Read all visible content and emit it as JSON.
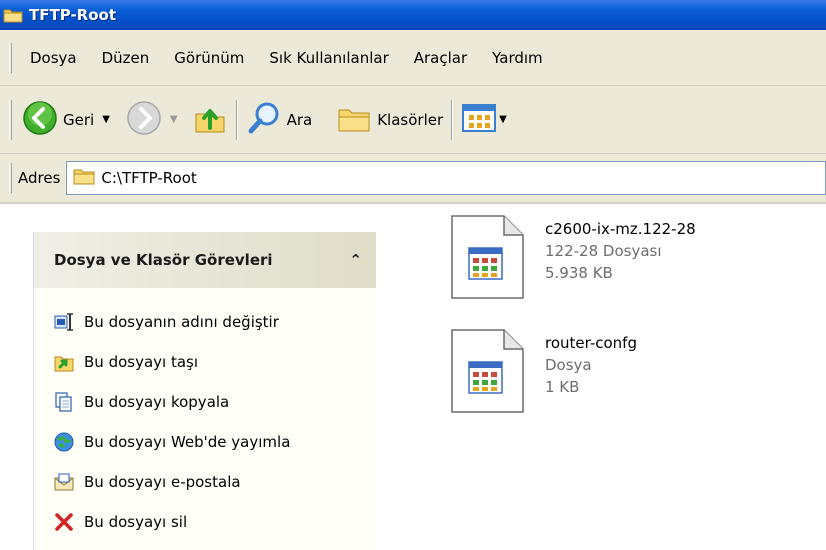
{
  "window": {
    "title": "TFTP-Root"
  },
  "menu": {
    "items": [
      "Dosya",
      "Düzen",
      "Görünüm",
      "Sık Kullanılanlar",
      "Araçlar",
      "Yardım"
    ]
  },
  "toolbar": {
    "back_label": "Geri",
    "search_label": "Ara",
    "folders_label": "Klasörler"
  },
  "address": {
    "label": "Adres",
    "value": "C:\\TFTP-Root"
  },
  "tasks": {
    "title": "Dosya ve Klasör Görevleri",
    "collapse_glyph": "⌃",
    "items": [
      {
        "label": "Bu dosyanın adını değiştir",
        "icon": "rename-icon"
      },
      {
        "label": "Bu dosyayı taşı",
        "icon": "move-icon"
      },
      {
        "label": "Bu dosyayı kopyala",
        "icon": "copy-icon"
      },
      {
        "label": "Bu dosyayı Web'de yayımla",
        "icon": "publish-web-icon"
      },
      {
        "label": "Bu dosyayı e-postala",
        "icon": "email-icon"
      },
      {
        "label": "Bu dosyayı sil",
        "icon": "delete-icon"
      }
    ]
  },
  "files": [
    {
      "name": "c2600-ix-mz.122-28",
      "type": "122-28 Dosyası",
      "size": "5.938 KB"
    },
    {
      "name": "router-confg",
      "type": "Dosya",
      "size": "1 KB"
    }
  ],
  "colors": {
    "titlebar": "#0550c8",
    "chrome": "#ece9d8",
    "delete": "#d42020"
  }
}
